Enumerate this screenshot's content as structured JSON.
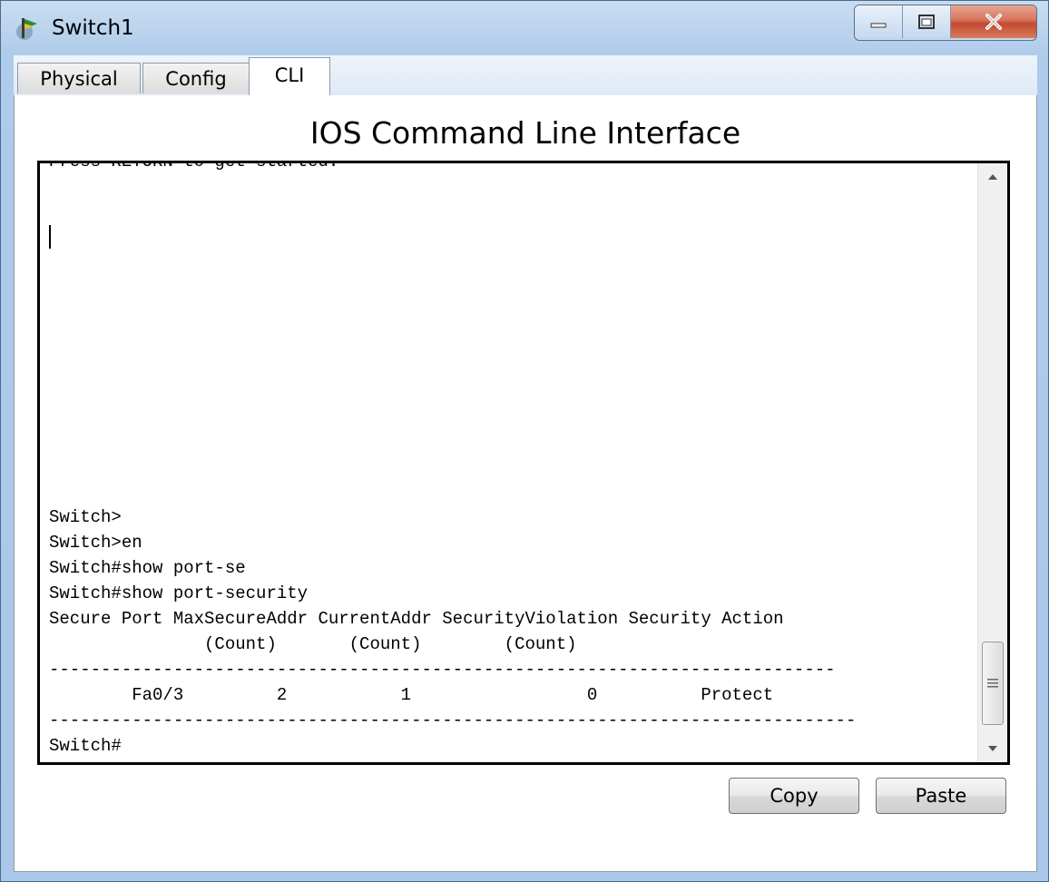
{
  "window": {
    "title": "Switch1",
    "controls": {
      "minimize": "minimize",
      "maximize": "maximize",
      "close": "close"
    }
  },
  "tabs": [
    {
      "label": "Physical",
      "active": false
    },
    {
      "label": "Config",
      "active": false
    },
    {
      "label": "CLI",
      "active": true
    }
  ],
  "cli": {
    "heading": "IOS Command Line Interface",
    "lines": [
      "Press RETURN to get started.",
      "",
      "",
      "",
      "",
      "",
      "",
      "",
      "",
      "",
      "",
      "",
      "",
      "",
      "Switch>",
      "Switch>en",
      "Switch#show port-se",
      "Switch#show port-security",
      "Secure Port MaxSecureAddr CurrentAddr SecurityViolation Security Action",
      "               (Count)       (Count)        (Count)",
      "----------------------------------------------------------------------------",
      "        Fa0/3         2           1                 0          Protect",
      "------------------------------------------------------------------------------",
      "Switch#"
    ]
  },
  "buttons": {
    "copy": "Copy",
    "paste": "Paste"
  },
  "colors": {
    "title_bar": "#b8d1ec",
    "close_button": "#c24a30",
    "terminal_border": "#000000"
  }
}
